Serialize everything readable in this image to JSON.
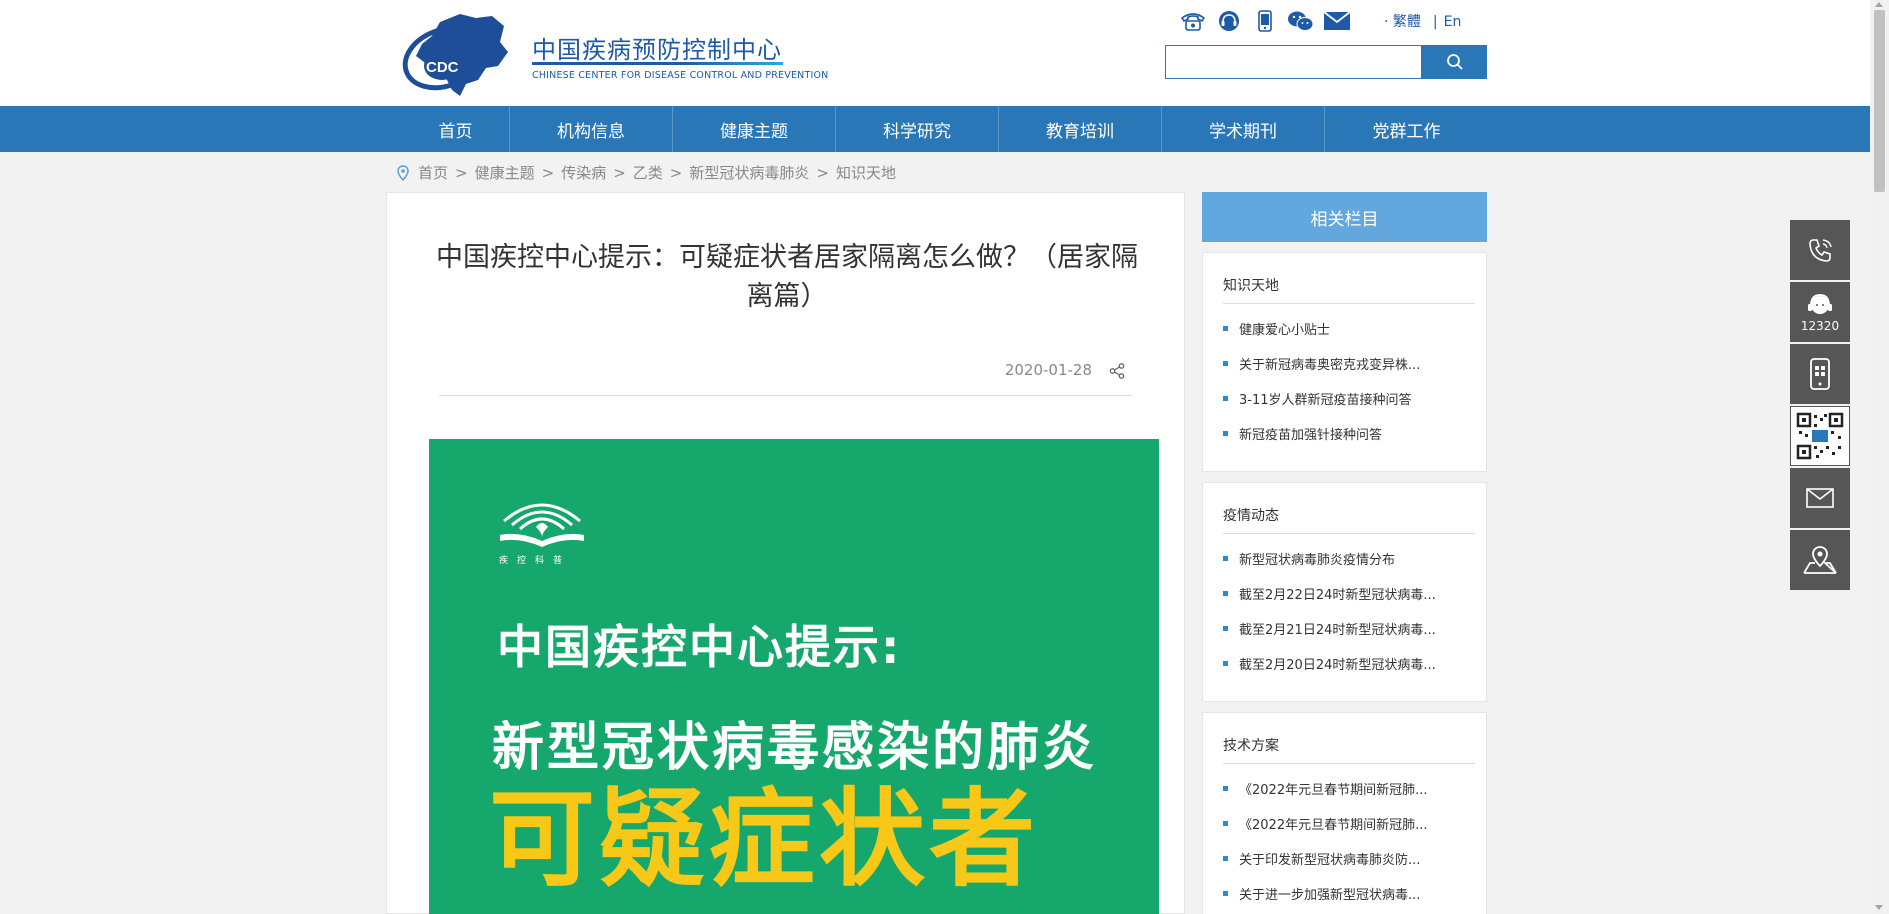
{
  "header": {
    "logo_badge": "CDC",
    "logo_title": "中国疾病预防控制中心",
    "logo_subtitle": "CHINESE CENTER FOR DISEASE CONTROL AND PREVENTION",
    "tool_icons": [
      "phone-icon",
      "hotline-icon",
      "mobile-icon",
      "wechat-icon",
      "mail-icon"
    ],
    "lang_traditional": "· 繁體",
    "lang_separator": "|",
    "lang_english": "En",
    "search_value": ""
  },
  "nav": {
    "items": [
      "首页",
      "机构信息",
      "健康主题",
      "科学研究",
      "教育培训",
      "学术期刊",
      "党群工作"
    ]
  },
  "breadcrumb": {
    "items": [
      "首页",
      "健康主题",
      "传染病",
      "乙类",
      "新型冠状病毒肺炎",
      "知识天地"
    ],
    "separator": ">"
  },
  "article": {
    "title": "中国疾控中心提示：可疑症状者居家隔离怎么做？（居家隔离篇）",
    "date": "2020-01-28",
    "poster": {
      "logo_text": "疾控科普",
      "line1": "中国疾控中心提示:",
      "line2": "新型冠状病毒感染的肺炎",
      "line3": "可疑症状者"
    }
  },
  "sidebar": {
    "heading": "相关栏目",
    "sections": [
      {
        "title": "知识天地",
        "items": [
          "健康爱心小贴士",
          "关于新冠病毒奥密克戎变异株...",
          "3-11岁人群新冠疫苗接种问答",
          "新冠疫苗加强针接种问答"
        ]
      },
      {
        "title": "疫情动态",
        "items": [
          "新型冠状病毒肺炎疫情分布",
          "截至2月22日24时新型冠状病毒...",
          "截至2月21日24时新型冠状病毒...",
          "截至2月20日24时新型冠状病毒..."
        ]
      },
      {
        "title": "技术方案",
        "items": [
          "《2022年元旦春节期间新冠肺...",
          "《2022年元旦春节期间新冠肺...",
          "关于印发新型冠状病毒肺炎防...",
          "关于进一步加强新型冠状病毒..."
        ]
      }
    ]
  },
  "float_bar": {
    "hotline_label": "12320",
    "buttons": [
      "phone-icon",
      "hotline-icon",
      "mobile-icon",
      "qrcode-icon",
      "mail-icon",
      "map-location-icon"
    ]
  },
  "colors": {
    "brand_blue": "#2a77b8",
    "sidebar_head": "#62a8df",
    "poster_green": "#16a76d",
    "poster_yellow": "#f7c817"
  }
}
